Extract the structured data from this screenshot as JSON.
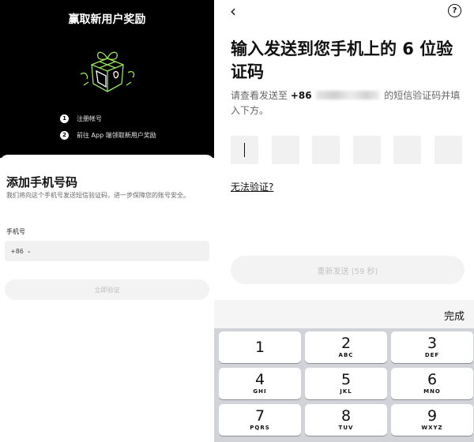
{
  "left": {
    "promo_title": "赢取新用户奖励",
    "steps": [
      {
        "num": "1",
        "text": "注册帐号"
      },
      {
        "num": "2",
        "text": "前往 App 端领取新用户奖励"
      }
    ],
    "sheet_title": "添加手机号码",
    "sheet_desc": "我们将向这个手机号发送短信验证码，进一步保障您的账号安全。",
    "phone_label": "手机号",
    "country_code": "+86",
    "phone_value": "",
    "verify_button": "立即验证"
  },
  "right": {
    "heading": "输入发送到您手机上的 6 位验证码",
    "sub_prefix": "请查看发送至",
    "sub_code": "+86",
    "sub_suffix": "的短信验证码并填入下方。",
    "code_boxes": [
      "",
      "",
      "",
      "",
      "",
      ""
    ],
    "cant_verify": "无法验证?",
    "resend_button": "重新发送 (59 秒)",
    "keyboard": {
      "done": "完成",
      "keys": [
        {
          "digit": "1",
          "letters": ""
        },
        {
          "digit": "2",
          "letters": "ABC"
        },
        {
          "digit": "3",
          "letters": "DEF"
        },
        {
          "digit": "4",
          "letters": "GHI"
        },
        {
          "digit": "5",
          "letters": "JKL"
        },
        {
          "digit": "6",
          "letters": "MNO"
        },
        {
          "digit": "7",
          "letters": "PQRS"
        },
        {
          "digit": "8",
          "letters": "TUV"
        },
        {
          "digit": "9",
          "letters": "WXYZ"
        }
      ]
    }
  },
  "icons": {
    "back": "back-chevron-icon",
    "help": "question-circle-icon",
    "gift": "gift-box-icon",
    "chevron": "chevron-down-icon"
  },
  "colors": {
    "promo_bg": "#000000",
    "accent": "#9be35c",
    "input_bg": "#f1f1f2",
    "disabled_text": "#bdbdbd",
    "keyboard_bg": "#d1d3d9"
  }
}
